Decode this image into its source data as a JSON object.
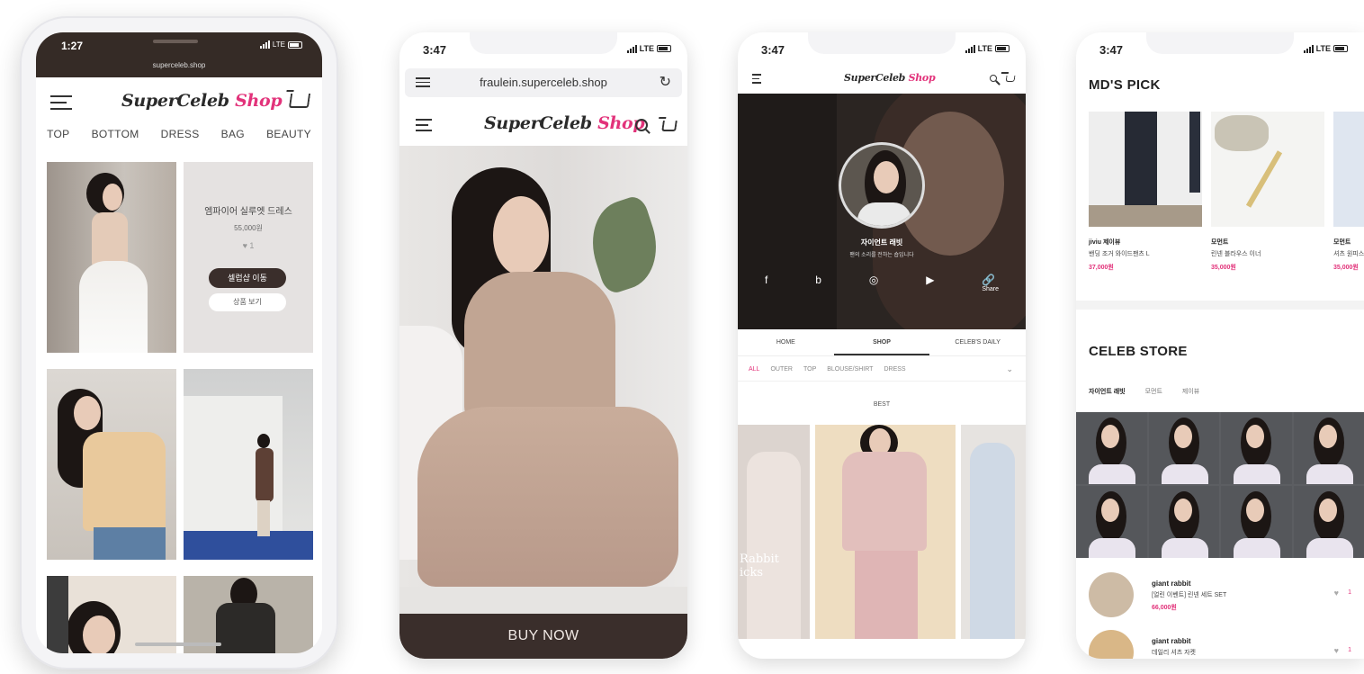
{
  "brand": {
    "logo_main": "SuperCeleb",
    "logo_shop": "Shop",
    "accent_color": "#e2327a",
    "dark_color": "#3a2e2b"
  },
  "phone1": {
    "time": "1:27",
    "network": "LTE",
    "url": "superceleb.shop",
    "categories": [
      "TOP",
      "BOTTOM",
      "DRESS",
      "BAG",
      "BEAUTY"
    ],
    "card": {
      "title": "엠파이어 실루엣 드레스",
      "price": "55,000원",
      "likes": "1",
      "primary_button": "셀럽샵 이동",
      "secondary_button": "상품 보기"
    }
  },
  "phone2": {
    "time": "3:47",
    "network": "LTE",
    "url": "fraulein.superceleb.shop",
    "buy_label": "BUY NOW"
  },
  "phone3": {
    "time": "3:47",
    "network": "LTE",
    "profile_name": "자이언트 래빗",
    "profile_desc": "팬의 소리를 전하는 숍입니다",
    "social": [
      "f",
      "b",
      "◎",
      "▶",
      "Share"
    ],
    "tabs": [
      "HOME",
      "SHOP",
      "CELEB'S DAILY"
    ],
    "subcats": [
      "ALL",
      "OUTER",
      "TOP",
      "BLOUSE/SHIRT",
      "DRESS"
    ],
    "filter_label": "BEST",
    "overlay_text": "Rabbit\nicks"
  },
  "phone4": {
    "time": "3:47",
    "network": "LTE",
    "mds_title": "MD'S PICK",
    "md_items": [
      {
        "t1": "jiviu 제이뷰",
        "t2": "밴딩 조거 와이드팬츠 L",
        "price": "37,000원"
      },
      {
        "t1": "모먼트",
        "t2": "린넨 블라우스 이너",
        "price": "35,000원"
      },
      {
        "t1": "모먼트",
        "t2": "셔츠 원피스",
        "price": "35,000원"
      }
    ],
    "store_title": "CELEB STORE",
    "store_tabs": [
      "자이언트 래빗",
      "모먼트",
      "제이뷰"
    ],
    "list": [
      {
        "name": "giant rabbit",
        "desc": "[얼린 이벤트] 린넨 세트 SET",
        "price": "66,000원",
        "likes": "1"
      },
      {
        "name": "giant rabbit",
        "desc": "데일리 셔츠 자켓",
        "price": "",
        "likes": "1"
      }
    ]
  }
}
